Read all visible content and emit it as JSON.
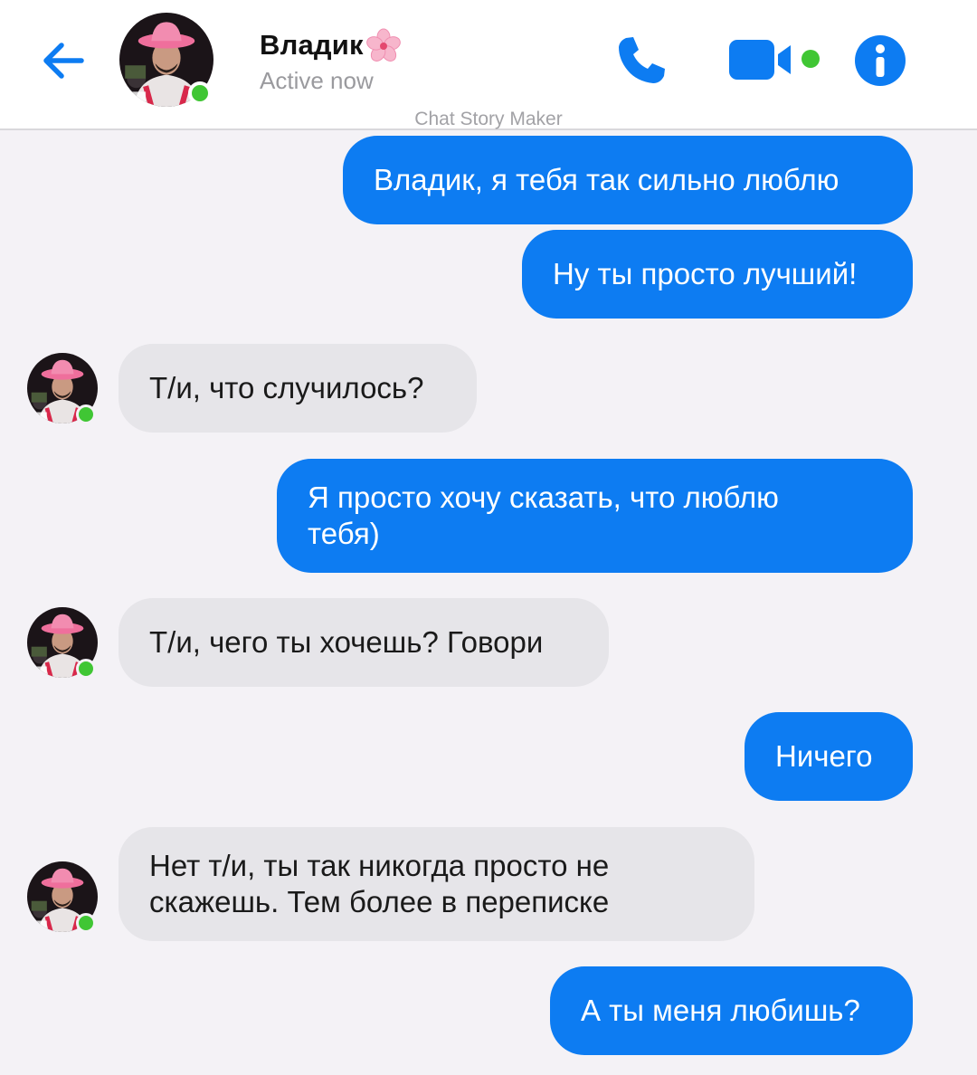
{
  "header": {
    "contact_name": "Владик",
    "status": "Active now",
    "watermark": "Chat Story Maker",
    "icons": [
      "back-arrow-icon",
      "avatar",
      "flower-emoji",
      "phone-icon",
      "video-camera-icon",
      "info-icon"
    ]
  },
  "messages": [
    {
      "from": "me",
      "text": "Владик, я тебя так сильно люблю"
    },
    {
      "from": "me",
      "text": "Ну ты просто лучший!"
    },
    {
      "from": "contact",
      "text": "Т/и, что случилось?"
    },
    {
      "from": "me",
      "lines": [
        "Я просто хочу сказать, что люблю",
        "тебя)"
      ]
    },
    {
      "from": "contact",
      "text": "Т/и, чего ты хочешь? Говори"
    },
    {
      "from": "me",
      "text": "Ничего"
    },
    {
      "from": "contact",
      "lines": [
        "Нет т/и, ты так никогда просто не",
        "скажешь. Тем более в переписке"
      ]
    },
    {
      "from": "me",
      "text": "А ты меня любишь?"
    }
  ],
  "colors": {
    "accent": "#0d7cf2",
    "outgoing_bubble": "#0d7cf2",
    "incoming_bubble": "#e6e5e9",
    "online_dot": "#40c634",
    "background": "#f4f2f6"
  }
}
